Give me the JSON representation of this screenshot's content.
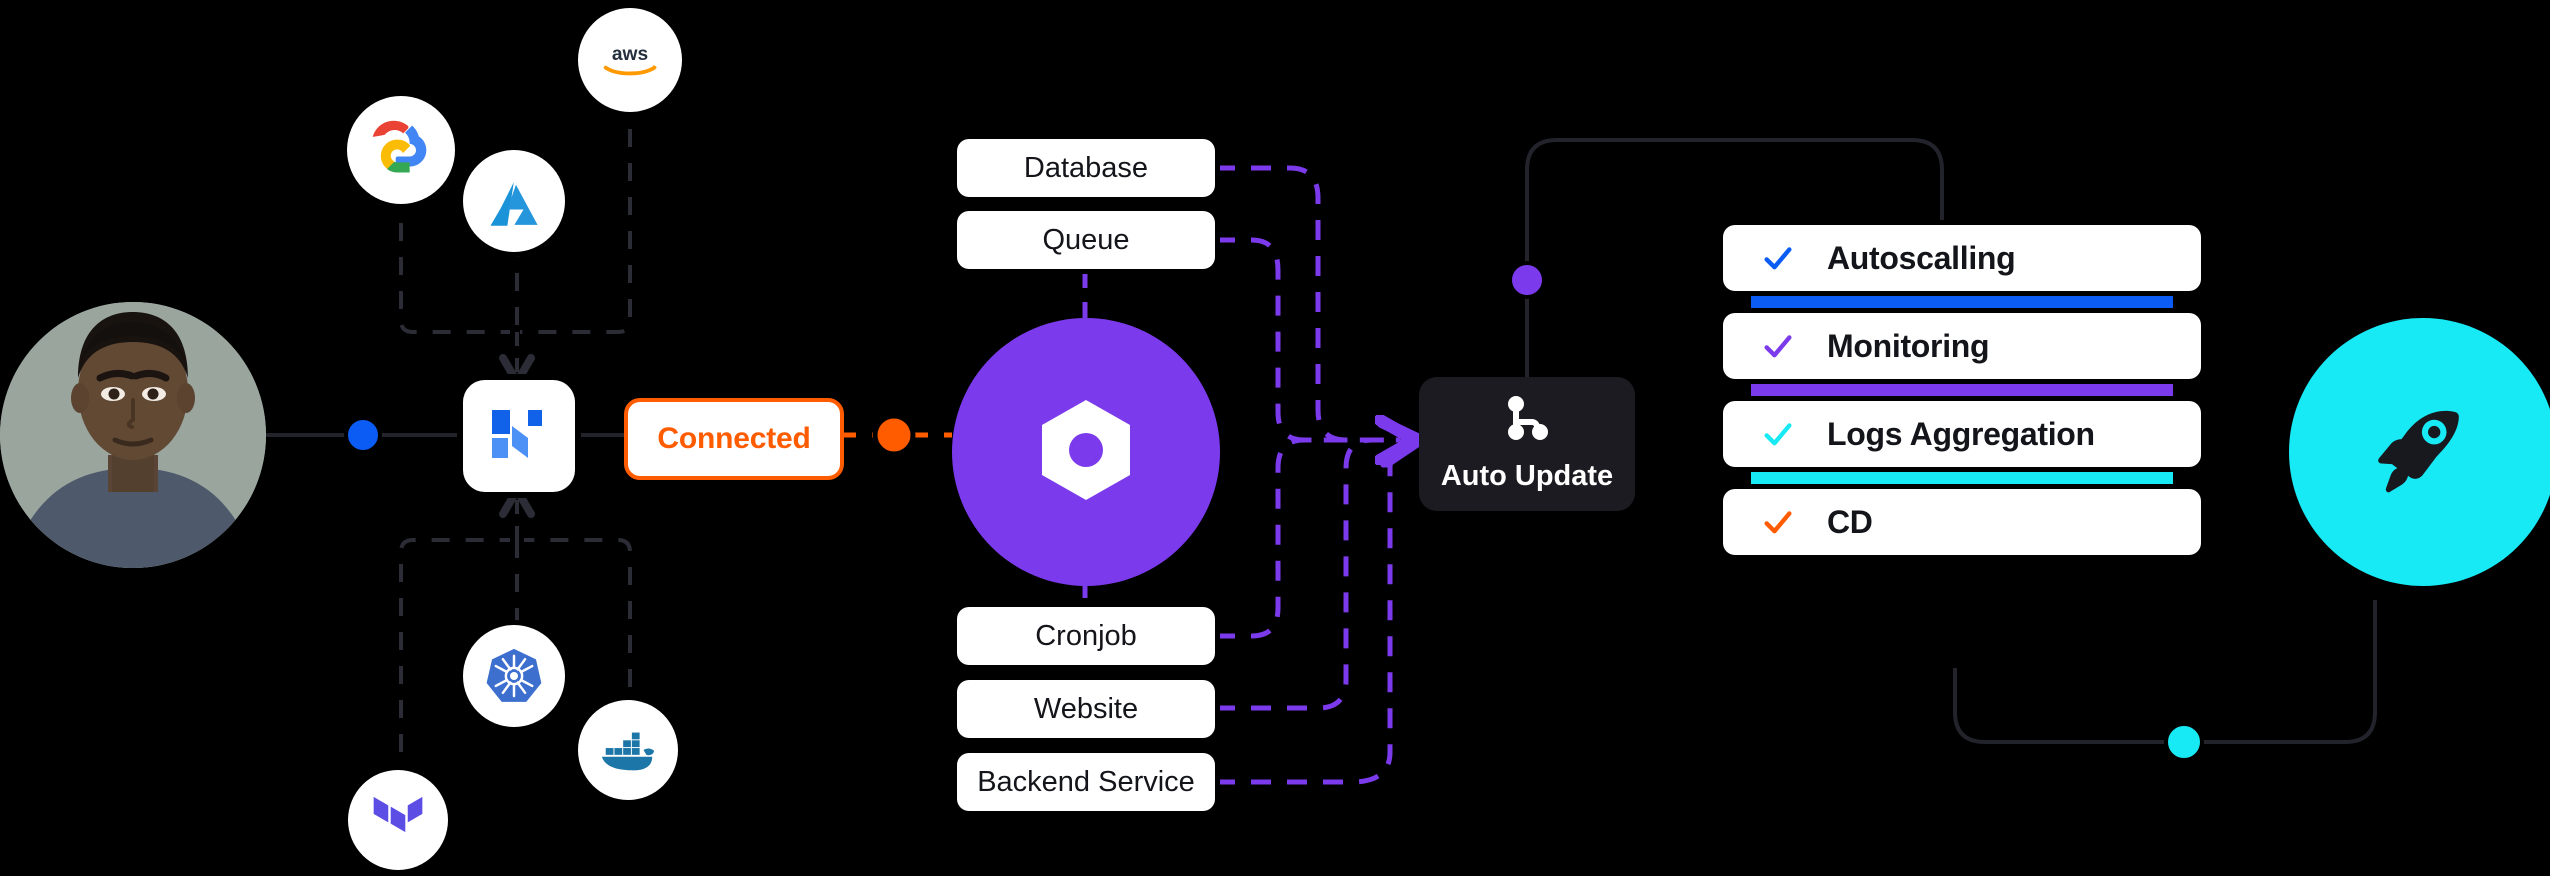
{
  "theme": {
    "background": "#000000",
    "card_bg": "#ffffff",
    "text_dark": "#14151a",
    "accent_orange": "#ff5c00",
    "accent_purple": "#7c3aed",
    "accent_blue": "#0b5cf5",
    "accent_cyan": "#18eaf5",
    "panel_dark": "#1b1b21",
    "wire_gray": "#22232b"
  },
  "user": {
    "avatar_name": "user-avatar",
    "alt": "portrait of a person"
  },
  "providers": [
    {
      "name": "google-cloud",
      "label": "Google Cloud"
    },
    {
      "name": "aws",
      "label": "aws"
    },
    {
      "name": "azure",
      "label": "Microsoft Azure"
    }
  ],
  "tools": [
    {
      "name": "kubernetes",
      "label": "Kubernetes"
    },
    {
      "name": "docker",
      "label": "Docker"
    },
    {
      "name": "terraform",
      "label": "Terraform"
    }
  ],
  "platform_node": {
    "name": "platform-logo",
    "label": "Platform"
  },
  "status_pill": {
    "label": "Connected",
    "color": "#ff5c00"
  },
  "hub": {
    "name": "hub-node",
    "label": "Platform Hub"
  },
  "services": {
    "top": [
      {
        "label": "Database"
      },
      {
        "label": "Queue"
      }
    ],
    "bottom": [
      {
        "label": "Cronjob"
      },
      {
        "label": "Website"
      },
      {
        "label": "Backend Service"
      }
    ]
  },
  "auto_update": {
    "label": "Auto Update",
    "icon": "git-branch-icon"
  },
  "checklist": [
    {
      "label": "Autoscalling",
      "check_color": "#0b5cf5",
      "bar_color": "#0b5cf5"
    },
    {
      "label": "Monitoring",
      "check_color": "#7c3aed",
      "bar_color": "#7c3aed"
    },
    {
      "label": "Logs Aggregation",
      "check_color": "#18eaf5",
      "bar_color": "#18eaf5"
    },
    {
      "label": "CD",
      "check_color": "#ff5c00",
      "bar_color": null
    }
  ],
  "deploy": {
    "name": "rocket-node",
    "label": "Deploy"
  },
  "connector_dots": [
    {
      "name": "dot-user-link",
      "color": "#0b5cf5"
    },
    {
      "name": "dot-connected-link",
      "color": "#ff5c00"
    },
    {
      "name": "dot-autoupdate-top",
      "color": "#7c3aed"
    },
    {
      "name": "dot-deploy-bottom",
      "color": "#18eaf5"
    }
  ]
}
